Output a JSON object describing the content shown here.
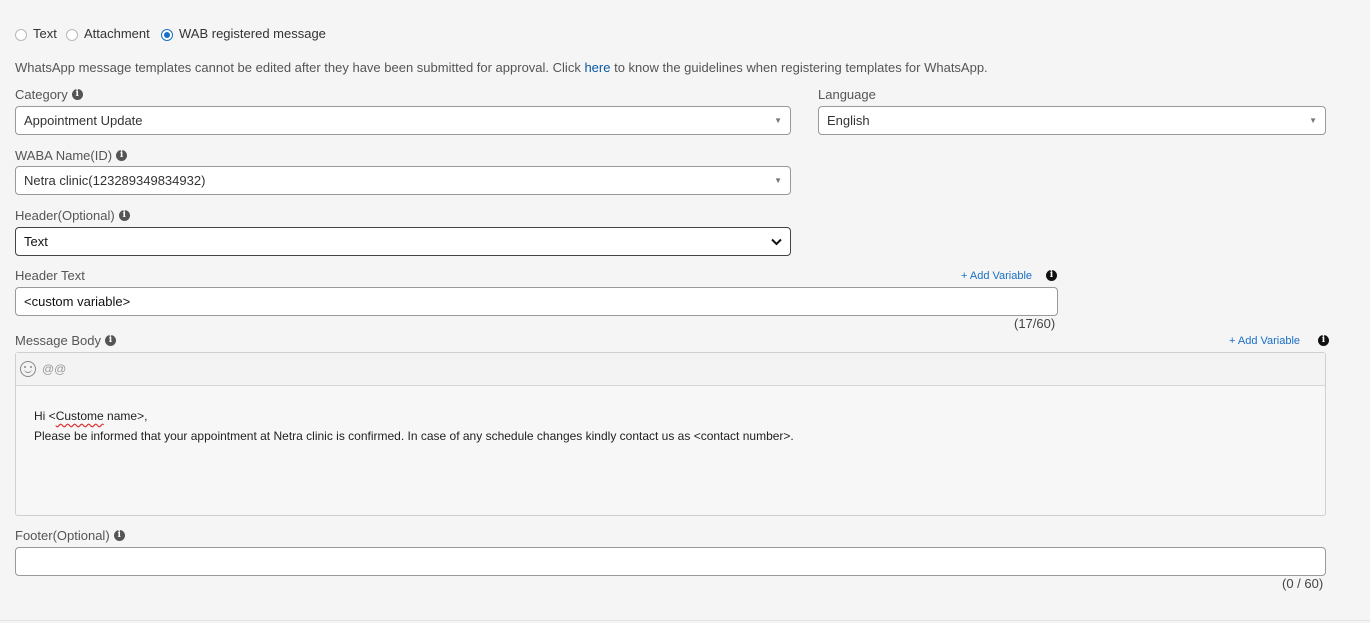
{
  "message_type": {
    "options": [
      "Text",
      "Attachment",
      "WAB registered message"
    ],
    "selected": "WAB registered message"
  },
  "info": {
    "prefix": "WhatsApp message templates cannot be edited after they have been submitted for approval. Click ",
    "link": "here",
    "suffix": " to know the guidelines when registering templates for WhatsApp."
  },
  "category": {
    "label": "Category",
    "value": "Appointment Update"
  },
  "language": {
    "label": "Language",
    "value": "English"
  },
  "waba": {
    "label": "WABA Name(ID)",
    "value": "Netra clinic(123289349834932)"
  },
  "header_type": {
    "label": "Header(Optional)",
    "value": "Text"
  },
  "header_text": {
    "label": "Header Text",
    "add_variable": "+ Add Variable",
    "value": "<custom variable>",
    "counter": "(17/60)"
  },
  "message_body": {
    "label": "Message Body",
    "add_variable": "+ Add Variable",
    "mention_button": "@@",
    "line1_prefix": "Hi <",
    "line1_misspelled": "Custome",
    "line1_suffix": " name>,",
    "line2": "Please be informed that your appointment at Netra clinic is confirmed. In case of any schedule changes kindly contact us as <contact number>."
  },
  "footer": {
    "label": "Footer(Optional)",
    "value": "",
    "counter": "(0 / 60)"
  },
  "colors": {
    "accent": "#1a6fc4",
    "background": "#f5f5f5"
  }
}
